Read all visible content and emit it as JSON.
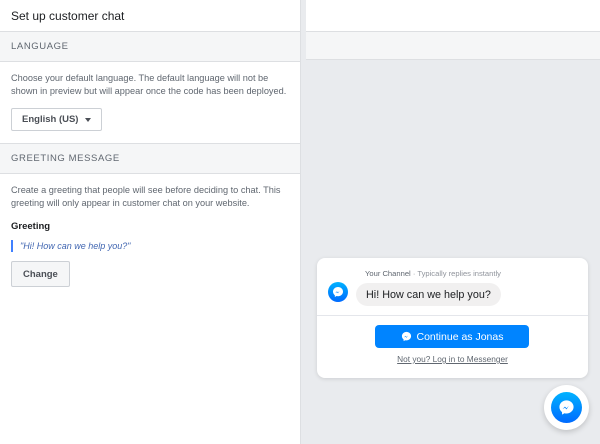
{
  "header": {
    "title": "Set up customer chat"
  },
  "language": {
    "section_title": "LANGUAGE",
    "description": "Choose your default language. The default language will not be shown in preview but will appear once the code has been deployed.",
    "selected": "English (US)"
  },
  "greeting": {
    "section_title": "GREETING MESSAGE",
    "description": "Create a greeting that people will see before deciding to chat. This greeting will only appear in customer chat on your website.",
    "label": "Greeting",
    "value": "\"Hi! How can we help you?\"",
    "change_label": "Change"
  },
  "preview": {
    "channel_name": "Your Channel",
    "separator": " · ",
    "reply_status": "Typically replies instantly",
    "message": "Hi! How can we help you?",
    "continue_label": "Continue as Jonas",
    "alt_login": "Not you? Log in to Messenger"
  },
  "colors": {
    "messenger_blue": "#0084ff",
    "link_blue": "#4267b2",
    "panel_gray": "#e9ebee"
  },
  "icons": {
    "dropdown": "caret-down-icon",
    "messenger": "messenger-icon"
  }
}
